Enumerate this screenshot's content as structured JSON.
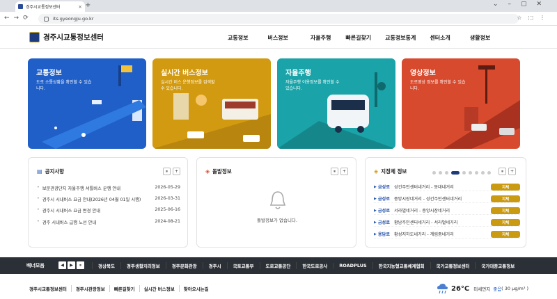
{
  "browser": {
    "tab_title": "경주시교통정보센터",
    "new_tab": "+",
    "url": "its.gyeongju.go.kr"
  },
  "header": {
    "logo_text": "경주시교통정보센터",
    "nav": [
      "교통정보",
      "버스정보",
      "자율주행",
      "빠른길찾기",
      "교통정보통계",
      "센터소개",
      "생활정보"
    ]
  },
  "cards": [
    {
      "title": "교통정보",
      "desc": "도로 소통상황을 확인할 수 있습니다.",
      "color": "#1f5fc7"
    },
    {
      "title": "실시간 버스정보",
      "desc": "실시간 버스 운행정보를 검색할 수 있습니다.",
      "color": "#d29a10"
    },
    {
      "title": "자율주행",
      "desc": "자율주행 이용정보를 확인할 수 있습니다.",
      "color": "#1aa3a8"
    },
    {
      "title": "영상정보",
      "desc": "도로영상 정보를 확인할 수 있습니다.",
      "color": "#d74a2e"
    }
  ],
  "notice": {
    "title": "공지사항",
    "items": [
      {
        "text": "보문관광단지 자율주행 셔틀버스 운행 안내",
        "date": "2026-05-29"
      },
      {
        "text": "경주시 시내버스 요금 안내(2026년 04월 01일 시행)",
        "date": "2026-03-31"
      },
      {
        "text": "경주시 시내버스 요금 변경 안내",
        "date": "2025-06-16"
      },
      {
        "text": "경주 시내버스 급행 노선 안내",
        "date": "2024-08-21"
      }
    ]
  },
  "incident": {
    "title": "돌발정보",
    "empty_message": "돌발정보가 없습니다."
  },
  "congestion": {
    "title": "지정체 정보",
    "items": [
      {
        "road": "금성로",
        "section": "성건주민센터네거리 - 동대네거리",
        "status": "지체"
      },
      {
        "road": "금성로",
        "section": "중앙시장네거리 - 성건주민센터네거리",
        "status": "지체"
      },
      {
        "road": "금성로",
        "section": "서라벌네거리 - 중앙시장네거리",
        "status": "지체"
      },
      {
        "road": "금성로",
        "section": "황남주민센터네거리 - 서라벌네거리",
        "status": "지체"
      },
      {
        "road": "용담로",
        "section": "황성지하도네거리 - 계림중네거리",
        "status": "지체"
      }
    ]
  },
  "controls": {
    "pause": "⏸",
    "plus": "+",
    "prev": "◀",
    "next": "▶"
  },
  "banner": {
    "label": "배너모음",
    "items": [
      "경상북도",
      "경주생활지리정보",
      "경주문화관광",
      "경주시",
      "국토교통부",
      "도로교통공단",
      "한국도로공사",
      "ROADPLUS",
      "한국지능형교통체계협회",
      "국가교통정보센터",
      "국가대중교통정보"
    ]
  },
  "footer": {
    "links": [
      "경주시교통정보센터",
      "경주시관광정보",
      "빠른길찾기",
      "실시간 버스정보",
      "찾아오시는길"
    ]
  },
  "weather": {
    "temp": "26°C",
    "dust_label": "미세먼지",
    "dust_status": "좋음",
    "dust_value": "( 30 μg/m³ )",
    "icon": "rain-cloud-icon"
  }
}
